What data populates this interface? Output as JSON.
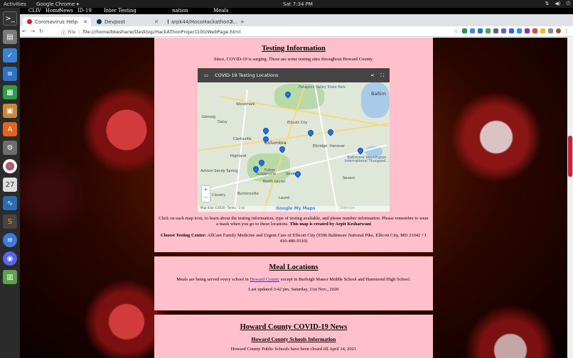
{
  "topbar": {
    "activities": "Activities",
    "app_name": "Google Chrome ▾",
    "clock": "Sat  7:34 PM"
  },
  "dock": {
    "apps": [
      "terminal-icon",
      "files-icon",
      "tasks-icon",
      "writer-icon",
      "calc-icon",
      "archive-icon",
      "software-icon",
      "settings-icon",
      "chrome-icon",
      "calendar-icon",
      "monitor-icon",
      "sublime-icon",
      "messaging-icon",
      "discord-icon",
      "fileroller-icon"
    ]
  },
  "browser": {
    "ghost_nav": [
      "CLIV",
      "Home",
      "News",
      "ID-19",
      "Inter",
      "Testing",
      "nation",
      "Meals"
    ],
    "tabs": [
      {
        "label": "Coronavirus Help",
        "favicon_color": "#e3162a",
        "active": true
      },
      {
        "label": "Devpost",
        "favicon_color": "#003e54",
        "active": false
      },
      {
        "label": "arpk44/HocoHackathon2...",
        "favicon_color": "#222222",
        "active": false
      }
    ],
    "new_tab": "+",
    "address": {
      "scheme_label": "File",
      "url": "file:///home/bkesharw/Desktop/HackAThonProject100/WebPage.html"
    }
  },
  "testing": {
    "heading": "Testing Information",
    "intro": "Since, COVID-19 is surging. These are some testing sites throughout Howard County.",
    "map": {
      "title": "COVID-19 Testing Locations",
      "labels": [
        "Patapsco Valley State Park",
        "Baltim",
        "Woodmark",
        "Daisy",
        "Ellicott City",
        "Columbia",
        "Clarksville",
        "Elkridge",
        "Hanover",
        "Highland",
        "Baltimore Washington International Thurgood...",
        "Ashton-Sandy Spring",
        "Fulton",
        "Scaggsville",
        "Savage",
        "North Laurel",
        "Burtonsville",
        "Laurel",
        "Glenelg",
        "Odenton",
        "Severn",
        "Clovery"
      ],
      "zoom_in": "+",
      "zoom_out": "−",
      "footer": "Map data ©2020 · Terms · 2 mi",
      "logo": "Google My Maps"
    },
    "click_desc": "Click on each map icon, to learn about the testing information, type of testing avaliable, and phone number information. Please remember to wear a mask when you go to these locations.",
    "credit": "This map is created by Arpit Kesharwani",
    "closest_label": "Closest Testing Center:",
    "closest_value": "AllCare Family Medicine and Urgent Care of Ellicott City (9396 Baltimore National Pike, Ellicott City, MD 21042 +1 410-480-9110)"
  },
  "meals": {
    "heading": "Meal Locations",
    "info_before": "Meals are being served every school in",
    "info_link": "Howard County",
    "info_after": "except in Burleigh Manor Middle School and Hammond High School.",
    "updated": "Last updated 3:42 pm, Saturday, 21st Nov., 2020"
  },
  "news": {
    "heading": "Howard County COVID-19 News",
    "subheading": "Howard County Schools Information",
    "closing": "Howard County Public Schools have been closed till April 14, 2021"
  },
  "colors": {
    "panel_bg": "#ffc0cb",
    "scroll_thumb": "#e3162a"
  }
}
